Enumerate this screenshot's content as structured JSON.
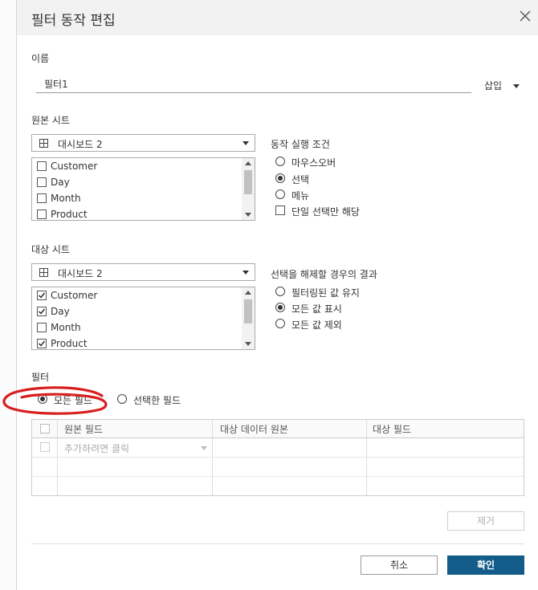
{
  "dialog": {
    "title": "필터 동작 편집"
  },
  "name": {
    "label": "이름",
    "value": "필터1",
    "insert_label": "삽입"
  },
  "source_sheets": {
    "label": "원본 시트",
    "selected": "대시보드 2",
    "items": [
      {
        "label": "Customer",
        "checked": false
      },
      {
        "label": "Day",
        "checked": false
      },
      {
        "label": "Month",
        "checked": false
      },
      {
        "label": "Product",
        "checked": false
      }
    ]
  },
  "run_action_on": {
    "label": "동작 실행 조건",
    "options": [
      {
        "label": "마우스오버",
        "selected": false
      },
      {
        "label": "선택",
        "selected": true
      },
      {
        "label": "메뉴",
        "selected": false
      }
    ],
    "single_select_only": {
      "label": "단일 선택만 해당",
      "checked": false
    }
  },
  "target_sheets": {
    "label": "대상 시트",
    "selected": "대시보드 2",
    "items": [
      {
        "label": "Customer",
        "checked": true
      },
      {
        "label": "Day",
        "checked": true
      },
      {
        "label": "Month",
        "checked": false
      },
      {
        "label": "Product",
        "checked": true
      }
    ]
  },
  "clearing_selection": {
    "label": "선택을 해제할 경우의 결과",
    "options": [
      {
        "label": "필터링된 값 유지",
        "selected": false
      },
      {
        "label": "모든 값 표시",
        "selected": true
      },
      {
        "label": "모든 값 제외",
        "selected": false
      }
    ]
  },
  "filter": {
    "label": "필터",
    "options": [
      {
        "label": "모든 필드",
        "selected": true
      },
      {
        "label": "선택한 필드",
        "selected": false
      }
    ],
    "columns": [
      "원본 필드",
      "대상 데이터 원본",
      "대상 필드"
    ],
    "add_placeholder": "추가하려면 클릭"
  },
  "buttons": {
    "remove": "제거",
    "cancel": "취소",
    "ok": "확인"
  },
  "colors": {
    "primary": "#135c89",
    "annotation": "#d81f1f"
  }
}
